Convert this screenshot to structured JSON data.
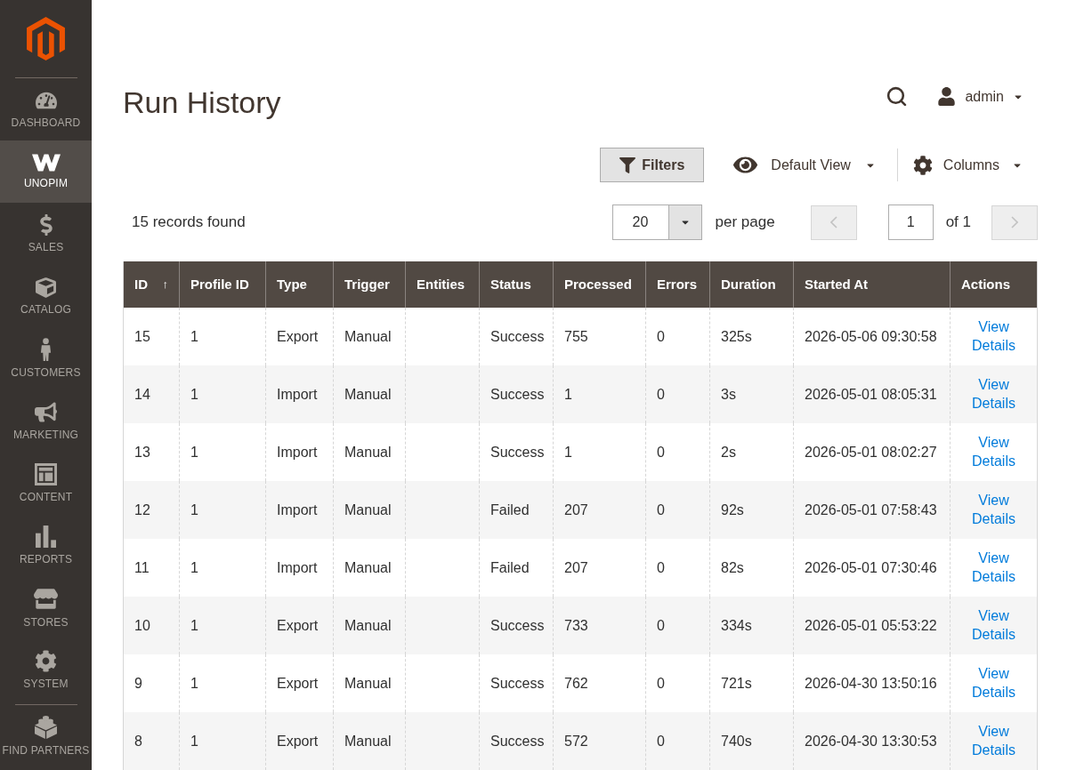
{
  "sidebar": {
    "items": [
      {
        "label": "DASHBOARD",
        "selected": false
      },
      {
        "label": "UNOPIM",
        "selected": true
      },
      {
        "label": "SALES",
        "selected": false
      },
      {
        "label": "CATALOG",
        "selected": false
      },
      {
        "label": "CUSTOMERS",
        "selected": false
      },
      {
        "label": "MARKETING",
        "selected": false
      },
      {
        "label": "CONTENT",
        "selected": false
      },
      {
        "label": "REPORTS",
        "selected": false
      },
      {
        "label": "STORES",
        "selected": false
      },
      {
        "label": "SYSTEM",
        "selected": false
      },
      {
        "label": "FIND PARTNERS",
        "selected": false
      }
    ]
  },
  "header": {
    "title": "Run History",
    "user": {
      "name": "admin"
    }
  },
  "toolbar": {
    "filters": "Filters",
    "view": "Default View",
    "columns": "Columns"
  },
  "pager": {
    "records": "15 records found",
    "per_page": {
      "value": "20",
      "label": "per page"
    },
    "previous": {
      "disabled": true
    },
    "page": {
      "value": "1",
      "total": "of 1"
    },
    "next": {
      "disabled": true
    }
  },
  "table": {
    "columns": [
      {
        "label": "ID",
        "sort_mark": "↑"
      },
      {
        "label": "Profile ID"
      },
      {
        "label": "Type"
      },
      {
        "label": "Trigger"
      },
      {
        "label": "Entities"
      },
      {
        "label": "Status"
      },
      {
        "label": "Processed"
      },
      {
        "label": "Errors"
      },
      {
        "label": "Duration"
      },
      {
        "label": "Started At"
      },
      {
        "label": "Actions"
      }
    ],
    "rows": [
      {
        "id": "15",
        "profile_id": "1",
        "type": "Export",
        "trigger": "Manual",
        "status": "Success",
        "processed": "755",
        "errors": "0",
        "duration": "325s",
        "started_at": "2026-05-06 09:30:58",
        "action": "View Details"
      },
      {
        "id": "14",
        "profile_id": "1",
        "type": "Import",
        "trigger": "Manual",
        "status": "Success",
        "processed": "1",
        "errors": "0",
        "duration": "3s",
        "started_at": "2026-05-01 08:05:31",
        "action": "View Details"
      },
      {
        "id": "13",
        "profile_id": "1",
        "type": "Import",
        "trigger": "Manual",
        "status": "Success",
        "processed": "1",
        "errors": "0",
        "duration": "2s",
        "started_at": "2026-05-01 08:02:27",
        "action": "View Details"
      },
      {
        "id": "12",
        "profile_id": "1",
        "type": "Import",
        "trigger": "Manual",
        "status": "Failed",
        "processed": "207",
        "errors": "0",
        "duration": "92s",
        "started_at": "2026-05-01 07:58:43",
        "action": "View Details"
      },
      {
        "id": "11",
        "profile_id": "1",
        "type": "Import",
        "trigger": "Manual",
        "status": "Failed",
        "processed": "207",
        "errors": "0",
        "duration": "82s",
        "started_at": "2026-05-01 07:30:46",
        "action": "View Details"
      },
      {
        "id": "10",
        "profile_id": "1",
        "type": "Export",
        "trigger": "Manual",
        "status": "Success",
        "processed": "733",
        "errors": "0",
        "duration": "334s",
        "started_at": "2026-05-01 05:53:22",
        "action": "View Details"
      },
      {
        "id": "9",
        "profile_id": "1",
        "type": "Export",
        "trigger": "Manual",
        "status": "Success",
        "processed": "762",
        "errors": "0",
        "duration": "721s",
        "started_at": "2026-04-30 13:50:16",
        "action": "View Details"
      },
      {
        "id": "8",
        "profile_id": "1",
        "type": "Export",
        "trigger": "Manual",
        "status": "Success",
        "processed": "572",
        "errors": "0",
        "duration": "740s",
        "started_at": "2026-04-30 13:30:53",
        "action": "View Details"
      }
    ]
  }
}
